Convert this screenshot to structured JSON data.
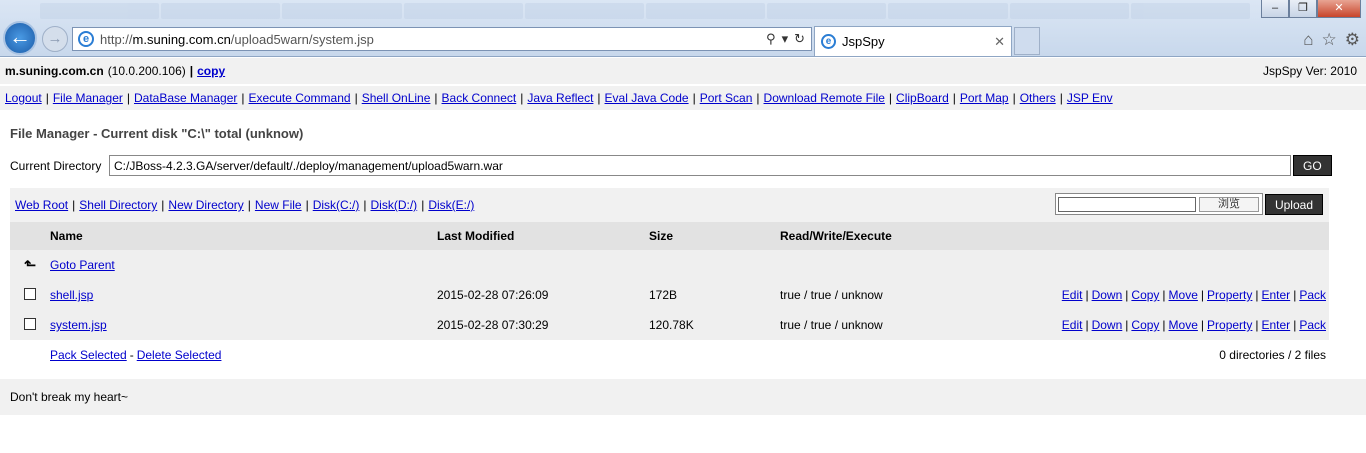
{
  "browser": {
    "url_prefix": "http://",
    "url_domain": "m.suning.com.cn",
    "url_path": "/upload5warn/system.jsp",
    "tab_title": "JspSpy"
  },
  "header": {
    "host": "m.suning.com.cn",
    "ip": "(10.0.200.106)",
    "sep": "|",
    "copy": "copy",
    "version": "JspSpy Ver: 2010"
  },
  "menu": [
    "Logout",
    "File Manager",
    "DataBase Manager",
    "Execute Command",
    "Shell OnLine",
    "Back Connect",
    "Java Reflect",
    "Eval Java Code",
    "Port Scan",
    "Download Remote File",
    "ClipBoard",
    "Port Map",
    "Others",
    "JSP Env"
  ],
  "page": {
    "title": "File Manager - Current disk \"C:\\\" total (unknow)",
    "current_dir_label": "Current Directory",
    "current_dir": "C:/JBoss-4.2.3.GA/server/default/./deploy/management/upload5warn.war",
    "go": "GO"
  },
  "toolbar": {
    "links": [
      "Web Root",
      "Shell Directory",
      "New Directory",
      "New File",
      "Disk(C:/)",
      "Disk(D:/)",
      "Disk(E:/)"
    ],
    "browse": "浏览",
    "upload": "Upload"
  },
  "table": {
    "headers": [
      "Name",
      "Last Modified",
      "Size",
      "Read/Write/Execute"
    ],
    "goto_parent": "Goto Parent",
    "rows": [
      {
        "name": "shell.jsp",
        "modified": "2015-02-28 07:26:09",
        "size": "172B",
        "rwx": "true / true / unknow"
      },
      {
        "name": "system.jsp",
        "modified": "2015-02-28 07:30:29",
        "size": "120.78K",
        "rwx": "true / true / unknow"
      }
    ],
    "actions": [
      "Edit",
      "Down",
      "Copy",
      "Move",
      "Property",
      "Enter",
      "Pack"
    ],
    "pack_selected": "Pack Selected",
    "delete_selected": "Delete Selected",
    "summary": "0 directories / 2 files"
  },
  "footer": "Don't break my heart~"
}
